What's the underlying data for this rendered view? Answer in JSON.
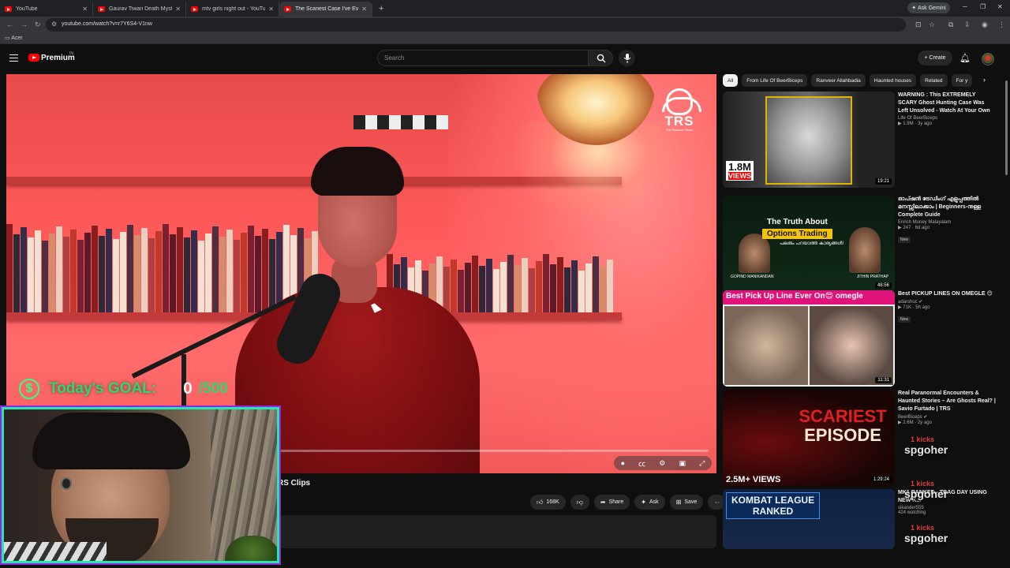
{
  "browser": {
    "tabs": [
      {
        "title": "YouTube",
        "active": false
      },
      {
        "title": "Gaurav Tiwari Death Mystery S",
        "active": false
      },
      {
        "title": "mtv girls night out - YouTube",
        "active": false
      },
      {
        "title": "The Scariest Case I've Ever Solv",
        "active": true
      }
    ],
    "gemini_label": "Ask Gemini",
    "url": "youtube.com/watch?v=r7Y6S4-V1nw",
    "bookmark": "Acer"
  },
  "masthead": {
    "brand": "Premium",
    "country": "IN",
    "search_placeholder": "Search",
    "create_label": "Create"
  },
  "overlay": {
    "goal_label": "Today's GOAL:",
    "goal_current": "0",
    "goal_target": "/500"
  },
  "video": {
    "channel_fragment": "RS Clips",
    "logo_text": "TRS",
    "logo_sub": "The Ranveer Show",
    "like_count": "168K",
    "share_label": "Share",
    "ask_label": "Ask",
    "save_label": "Save"
  },
  "chips": [
    "All",
    "From Life Of BeerBiceps",
    "Ranveer Allahbadia",
    "Haunted houses",
    "Related",
    "For y"
  ],
  "recommendations": [
    {
      "title": "WARNING : This EXTREMELY SCARY Ghost Hunting Case Was Left Unsolved - Watch At Your Own Risk",
      "channel": "Life Of BeerBiceps",
      "stats": "1.9M · 3y ago",
      "duration": "19:21",
      "new": false,
      "thumb_text": "1.8M",
      "thumb_text2": "VIEWS"
    },
    {
      "title": "ഓപ്ഷൻ ട്രേഡിംഗ് എളുപ്പത്തിൽ മനസ്സിലാക്കാം | Beginners-നുള്ള Complete Guide",
      "channel": "Enrich Money Malayalam",
      "stats": "247 · 6d ago",
      "duration": "48:56",
      "new": true,
      "thumb_text": "The Truth About",
      "thumb_text2": "Options Trading",
      "thumb_text3": "പലരും പറയാത്ത കാര്യങ്ങൾ!",
      "thumb_left": "GOPIND MANIKANDAN",
      "thumb_right": "JITHIN PRATHAP"
    },
    {
      "title": "Best PICKUP LINES ON OMEGLE 😊",
      "channel": "adarshuc",
      "stats": "71K · 5h ago",
      "duration": "11:31",
      "new": true,
      "thumb_text": "Best Pick Up Line Ever On😍 omegle"
    },
    {
      "title": "Real Paranormal Encounters & Haunted Stories – Are Ghosts Real? | Savio Furtado | TRS",
      "channel": "BeerBiceps",
      "stats": "2.6M · 2y ago",
      "duration": "1:29:24",
      "new": false,
      "thumb_text": "SCARIEST",
      "thumb_text2": "EPISODE",
      "thumb_text3": "2.5M+ VIEWS"
    },
    {
      "title": "MK1 RANKED - TBAG DAY USING NEW K...",
      "channel": "sikander555",
      "stats": "424 watching",
      "duration": "",
      "new": false,
      "thumb_text": "KOMBAT LEAGUE",
      "thumb_text2": "RANKED"
    }
  ],
  "kicks": [
    {
      "count": "1 kicks",
      "user": "spgoher"
    },
    {
      "count": "1 kicks",
      "user": "spgoher"
    },
    {
      "count": "1 kicks",
      "user": "spgoher"
    }
  ],
  "colors": {
    "accent": "#ff0000",
    "goal_green": "#2bd872",
    "webcam_border": "#28e6b0",
    "kicks_red": "#e03a3a"
  }
}
